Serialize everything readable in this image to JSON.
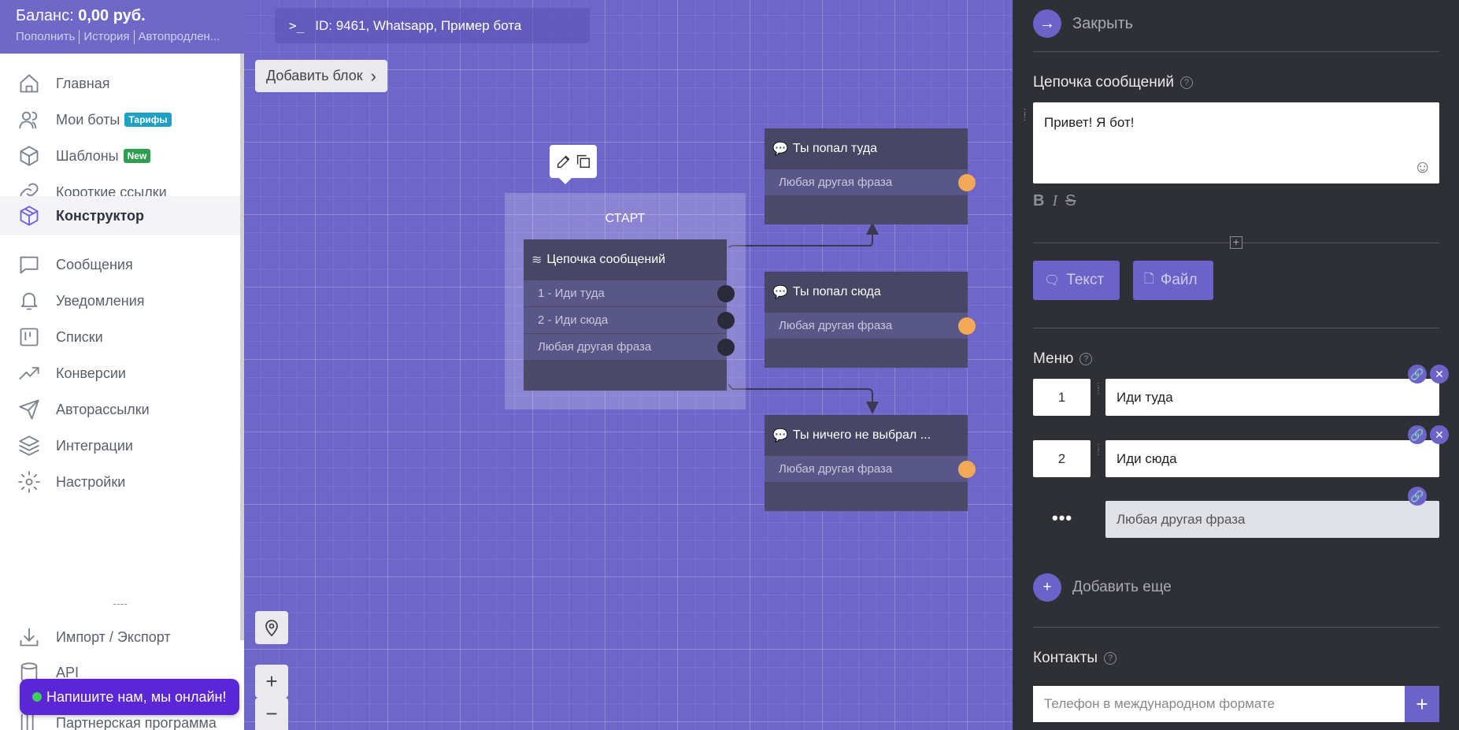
{
  "balance": {
    "label": "Баланс:",
    "amount": "0,00 руб.",
    "links": [
      "Пополнить",
      "История",
      "Автопродлен..."
    ]
  },
  "nav": {
    "items": [
      {
        "label": "Главная",
        "icon": "home-icon"
      },
      {
        "label": "Мои боты",
        "icon": "users-icon",
        "badge": "Тарифы"
      },
      {
        "label": "Шаблоны",
        "icon": "box-icon",
        "badge": "New"
      },
      {
        "label": "Короткие ссылки",
        "icon": "link-icon"
      },
      {
        "label": "Конструктор",
        "icon": "cube-icon"
      },
      {
        "label": "Сообщения",
        "icon": "message-icon"
      },
      {
        "label": "Уведомления",
        "icon": "bell-icon"
      },
      {
        "label": "Списки",
        "icon": "list-board-icon"
      },
      {
        "label": "Конверсии",
        "icon": "trend-icon"
      },
      {
        "label": "Авторассылки",
        "icon": "send-icon"
      },
      {
        "label": "Интеграции",
        "icon": "layers-icon"
      },
      {
        "label": "Настройки",
        "icon": "gear-icon"
      },
      {
        "label": "Импорт / Экспорт",
        "icon": "download-icon"
      },
      {
        "label": "API",
        "icon": "database-icon"
      },
      {
        "label": "Партнерская программа",
        "icon": "columns-icon"
      }
    ],
    "separator": "----",
    "active": "Конструктор"
  },
  "chat": {
    "label": "Напишите нам, мы онлайн!"
  },
  "canvas": {
    "bot_id": "ID: 9461, Whatsapp, Пример бота",
    "add_block": "Добавить блок",
    "start_label": "СТАРТ",
    "zoom_in": "+",
    "zoom_out": "−",
    "nodes": {
      "chain": {
        "title": "Цепочка сообщений",
        "rows": [
          "1 - Иди туда",
          "2 - Иди сюда",
          "Любая другая фраза"
        ]
      },
      "there": {
        "title": "Ты попал туда",
        "rows": [
          "Любая другая фраза"
        ]
      },
      "here": {
        "title": "Ты попал сюда",
        "rows": [
          "Любая другая фраза"
        ]
      },
      "none": {
        "title": "Ты ничего не выбрал ...",
        "rows": [
          "Любая другая фраза"
        ]
      }
    }
  },
  "panel": {
    "close_label": "Закрыть",
    "chain_title": "Цепочка сообщений",
    "message_text": "Привет! Я бот!",
    "format": [
      "B",
      "I",
      "S"
    ],
    "btn_text": "Текст",
    "btn_file": "Файл",
    "menu_title": "Меню",
    "menu": [
      {
        "num": "1",
        "text": "Иди туда"
      },
      {
        "num": "2",
        "text": "Иди сюда"
      }
    ],
    "menu_default": "Любая другая фраза",
    "add_more": "Добавить еще",
    "contacts_title": "Контакты",
    "phone_placeholder": "Телефон в международном формате"
  },
  "colors": {
    "accent": "#6c63c8",
    "canvas": "#6e66c9",
    "panel": "#2f3036",
    "orange_pin": "#f3a957"
  }
}
